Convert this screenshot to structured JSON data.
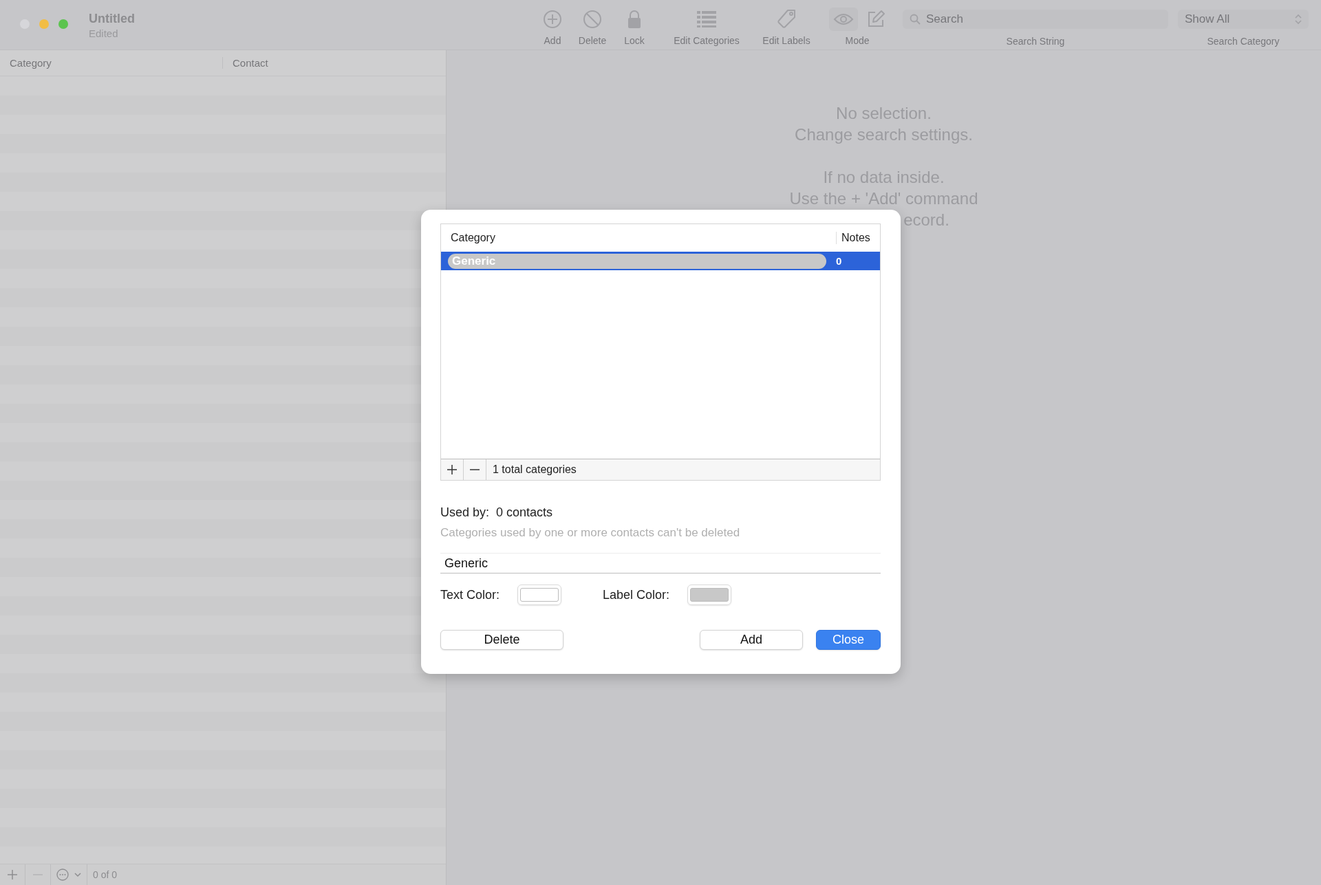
{
  "window": {
    "title": "Untitled",
    "subtitle": "Edited"
  },
  "toolbar": {
    "items": [
      {
        "kind": "add",
        "label": "Add"
      },
      {
        "kind": "delete",
        "label": "Delete"
      },
      {
        "kind": "lock",
        "label": "Lock"
      },
      {
        "kind": "categories",
        "label": "Edit Categories"
      },
      {
        "kind": "labels",
        "label": "Edit Labels"
      },
      {
        "kind": "mode",
        "label": "Mode"
      }
    ],
    "search": {
      "placeholder": "Search",
      "label": "Search String"
    },
    "category_popup": {
      "value": "Show All",
      "label": "Search Category"
    }
  },
  "list": {
    "columns": [
      "Category",
      "Contact"
    ],
    "footer": {
      "count": "0 of 0"
    }
  },
  "detail": {
    "lines": [
      {
        "text": "No selection.",
        "kind": "line"
      },
      {
        "text": "Change search settings.",
        "kind": "line"
      },
      {
        "kind": "gap"
      },
      {
        "text": "If no data inside.",
        "kind": "line"
      },
      {
        "text": "Use the + 'Add' command",
        "kind": "line"
      },
      {
        "text": "ecord.",
        "kind": "covered"
      }
    ]
  },
  "dialog": {
    "table": {
      "columns": [
        "Category",
        "Notes"
      ],
      "rows": [
        {
          "category": "Generic",
          "notes": "0",
          "selected": true
        }
      ],
      "footer": "1 total categories"
    },
    "used_by_label": "Used by:",
    "used_by_value": "0 contacts",
    "hint": "Categories used by one or more contacts can't be deleted",
    "name_field": {
      "value": "Generic"
    },
    "text_color": {
      "label": "Text Color:",
      "color": "#ffffff"
    },
    "label_color": {
      "label": "Label Color:",
      "color": "#c8c8c8"
    },
    "buttons": [
      {
        "label": "Delete",
        "kind": "normal"
      },
      {
        "label": "Add",
        "kind": "normal"
      },
      {
        "label": "Close",
        "kind": "primary"
      }
    ]
  }
}
